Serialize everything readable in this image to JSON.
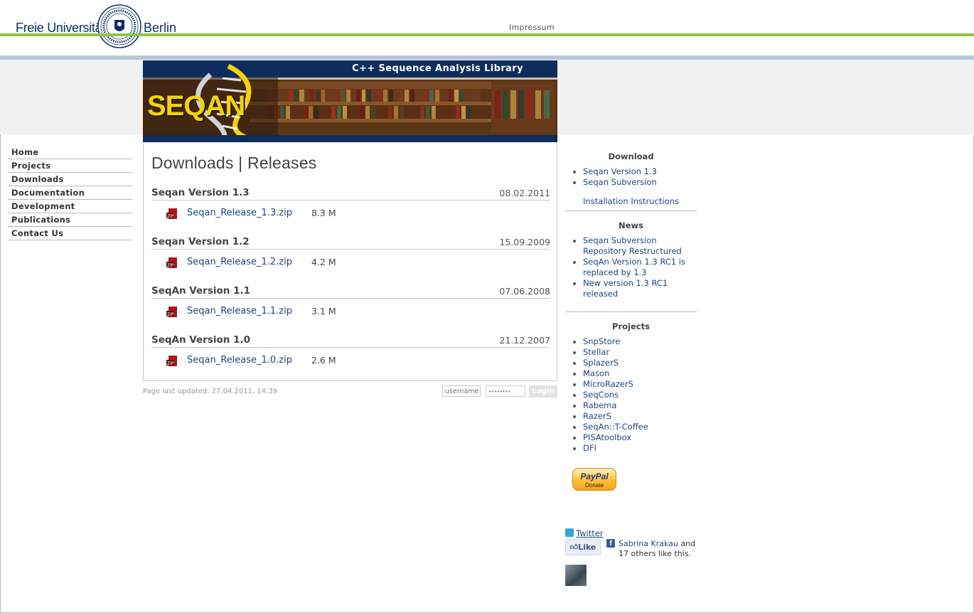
{
  "header": {
    "institution_left": "Freie Universität",
    "institution_right": "Berlin",
    "impressum": "Impressum"
  },
  "banner": {
    "tagline": "C++ Sequence Analysis Library",
    "logo_text": "SEQAN"
  },
  "nav": {
    "items": [
      {
        "label": "Home"
      },
      {
        "label": "Projects"
      },
      {
        "label": "Downloads"
      },
      {
        "label": "Documentation"
      },
      {
        "label": "Development"
      },
      {
        "label": "Publications"
      },
      {
        "label": "Contact Us"
      }
    ]
  },
  "main": {
    "title": "Downloads | Releases",
    "releases": [
      {
        "title": "Seqan Version 1.3",
        "date": "08.02.2011",
        "file": "Seqan_Release_1.3.zip",
        "size": "8.3 M"
      },
      {
        "title": "Seqan Version 1.2",
        "date": "15.09.2009",
        "file": "Seqan_Release_1.2.zip",
        "size": "4.2 M"
      },
      {
        "title": "SeqAn Version 1.1",
        "date": "07.06.2008",
        "file": "Seqan_Release_1.1.zip",
        "size": "3.1 M"
      },
      {
        "title": "SeqAn Version 1.0",
        "date": "21.12.2007",
        "file": "Seqan_Release_1.0.zip",
        "size": "2.6 M"
      }
    ],
    "file_icon_label": "ZIP"
  },
  "footer": {
    "last_updated": "Page last updated: 27.04.2011, 14:39",
    "username_placeholder": "username",
    "password_placeholder": "••••••••",
    "login_label": "Login"
  },
  "sidebar": {
    "download": {
      "title": "Download",
      "items": [
        "Seqan Version 1.3",
        "Seqan Subversion"
      ],
      "install": "Installation Instructions"
    },
    "news": {
      "title": "News",
      "items": [
        "Seqan Subversion Repository Restructured",
        "SeqAn Version 1.3 RC1 is replaced by 1.3",
        "New version 1.3 RC1 released"
      ]
    },
    "projects": {
      "title": "Projects",
      "items": [
        "SnpStore",
        "Stellar",
        "SplazerS",
        "Mason",
        "MicroRazerS",
        "SeqCons",
        "Rabema",
        "RazerS",
        "SeqAn::T-Coffee",
        "PISAtoolbox",
        "DFI"
      ]
    },
    "paypal": {
      "brand": "PayPal",
      "label": "Donate"
    },
    "twitter": "Twitter",
    "facebook": {
      "like": "Like",
      "icon_letter": "f",
      "name": "Sabrina Krakau",
      "after_name": " and",
      "others": "17 others like this."
    }
  },
  "colors": {
    "accent_green": "#8cc63f",
    "link_blue": "#1c4680",
    "banner_navy": "#0e2d5c",
    "logo_yellow": "#f5d10c"
  }
}
